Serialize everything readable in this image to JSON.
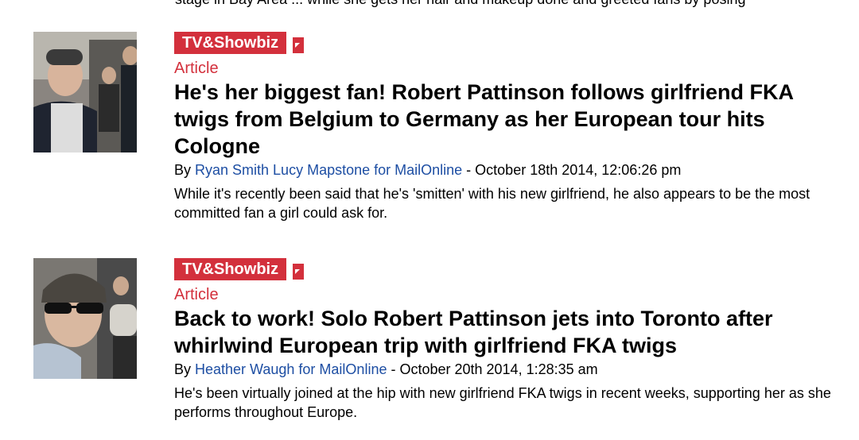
{
  "cutoff_text": "stage in Bay Area ... while she gets her hair and makeup done and greeted fans by posing",
  "articles": [
    {
      "category": "TV&Showbiz",
      "type": "Article",
      "headline": "He's her biggest fan! Robert Pattinson follows girlfriend FKA twigs from Belgium to Germany as her European tour hits Cologne",
      "by": "By ",
      "author": "Ryan Smith Lucy Mapstone for MailOnline",
      "date": " - October 18th 2014, 12:06:26 pm",
      "summary": "While it's recently been said that he's 'smitten' with his new girlfriend, he also appears to be the most committed fan a girl could ask for."
    },
    {
      "category": "TV&Showbiz",
      "type": "Article",
      "headline": "Back to work! Solo Robert Pattinson jets into Toronto after whirlwind European trip with girlfriend FKA twigs",
      "by": "By ",
      "author": "Heather Waugh for MailOnline",
      "date": " - October 20th 2014, 1:28:35 am",
      "summary": "He's been virtually joined at the hip with new girlfriend FKA twigs in recent weeks, supporting her as she performs throughout Europe."
    }
  ]
}
